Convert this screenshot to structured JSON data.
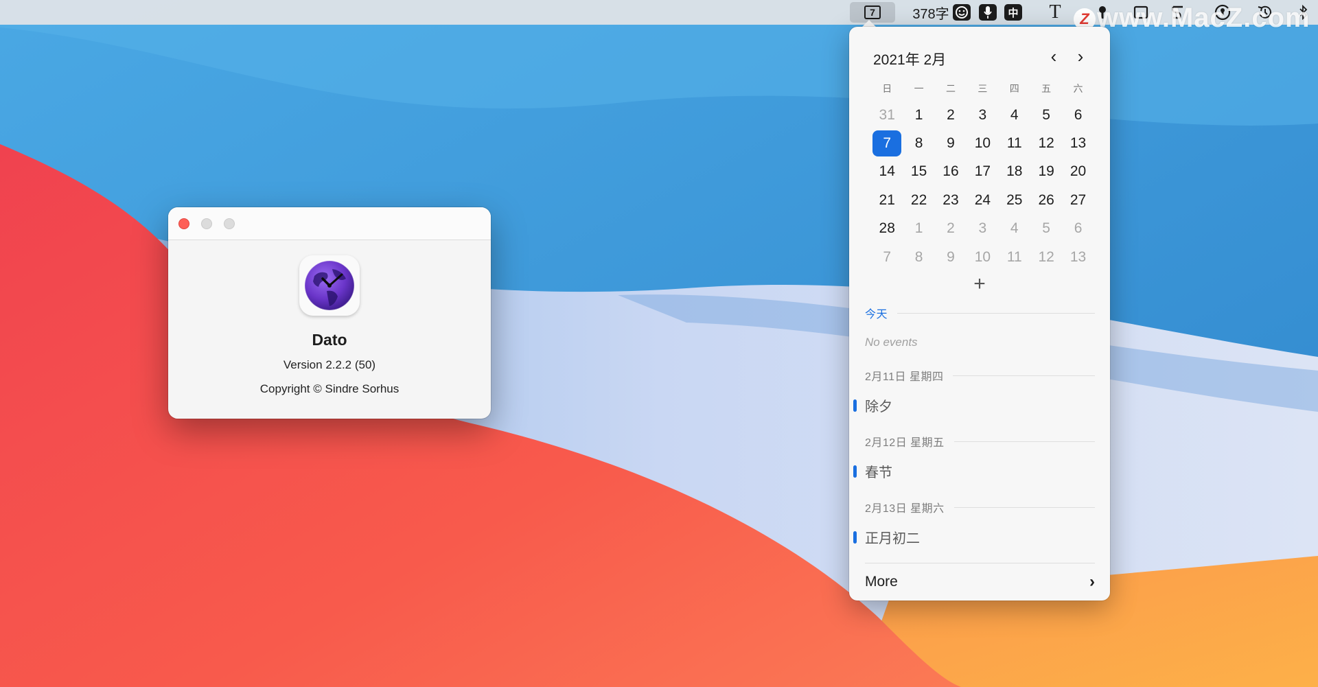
{
  "menubar": {
    "calendar_day": "7",
    "word_count": "378字",
    "input_method": "中",
    "text_icon": "T",
    "watermark": "www.MacZ.com",
    "watermark_logo": "Z"
  },
  "about_window": {
    "app_name": "Dato",
    "version": "Version 2.2.2 (50)",
    "copyright": "Copyright © Sindre Sorhus"
  },
  "calendar": {
    "month_title": "2021年 2月",
    "weekdays": [
      "日",
      "一",
      "二",
      "三",
      "四",
      "五",
      "六"
    ],
    "weeks": [
      [
        "31",
        "1",
        "2",
        "3",
        "4",
        "5",
        "6"
      ],
      [
        "7",
        "8",
        "9",
        "10",
        "11",
        "12",
        "13"
      ],
      [
        "14",
        "15",
        "16",
        "17",
        "18",
        "19",
        "20"
      ],
      [
        "21",
        "22",
        "23",
        "24",
        "25",
        "26",
        "27"
      ],
      [
        "28",
        "1",
        "2",
        "3",
        "4",
        "5",
        "6"
      ],
      [
        "7",
        "8",
        "9",
        "10",
        "11",
        "12",
        "13"
      ]
    ],
    "today": "7",
    "add_symbol": "+",
    "prev_symbol": "‹",
    "next_symbol": "›"
  },
  "agenda": {
    "today_label": "今天",
    "no_events": "No events",
    "groups": [
      {
        "date": "2月11日  星期四",
        "event": "除夕"
      },
      {
        "date": "2月12日  星期五",
        "event": "春节"
      },
      {
        "date": "2月13日  星期六",
        "event": "正月初二"
      }
    ],
    "more_label": "More",
    "more_chevron": "›"
  },
  "colors": {
    "accent": "#1a6fe0",
    "close_button": "#fe5f57"
  }
}
